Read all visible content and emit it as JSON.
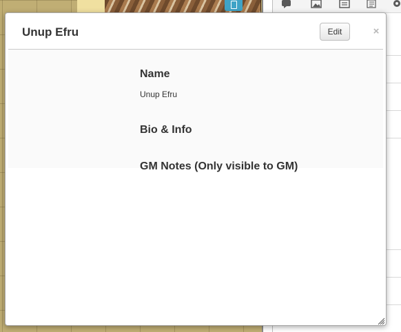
{
  "dialog": {
    "title": "Unup Efru",
    "edit_label": "Edit",
    "close_glyph": "×",
    "fields": {
      "name_heading": "Name",
      "name_value": "Unup Efru",
      "bio_heading": "Bio & Info",
      "gm_notes_heading": "GM Notes (Only visible to GM)"
    }
  },
  "sidebar": {
    "toolbar_icons": [
      "chat-icon",
      "image-icon",
      "journal-icon",
      "compendium-icon",
      "settings-icon"
    ]
  },
  "colors": {
    "token_marker": "#3fa3c6",
    "map_background": "#c0ae74",
    "dialog_background": "#ffffff"
  }
}
